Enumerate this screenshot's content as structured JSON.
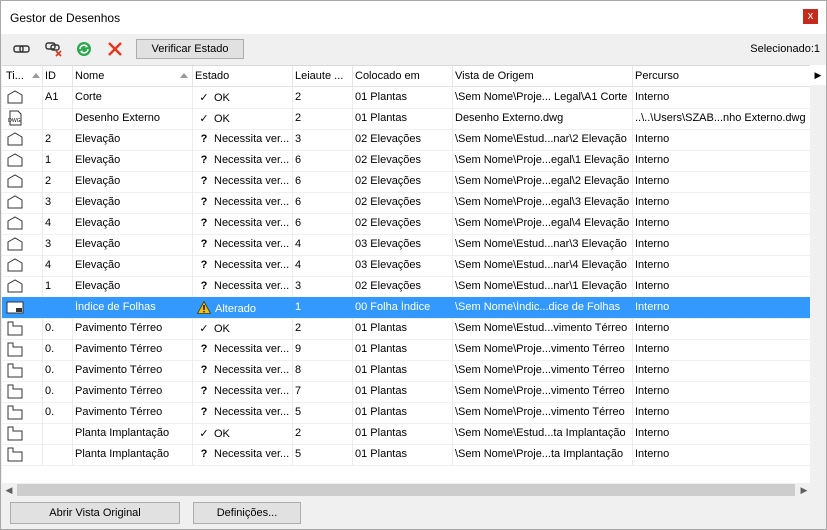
{
  "window": {
    "title": "Gestor de Desenhos",
    "close_symbol": "x"
  },
  "toolbar": {
    "verify_label": "Verificar Estado",
    "selected_label": "Selecionado:1"
  },
  "columns": [
    "Ti...",
    "ID",
    "Nome",
    "Estado",
    "Leiaute ...",
    "Colocado em",
    "Vista de Origem",
    "Percurso"
  ],
  "rows": [
    {
      "type": "section",
      "id": "A1",
      "name": "Corte",
      "status_icon": "check",
      "status": "OK",
      "layout": "2",
      "placed": "01 Plantas",
      "source": "\\Sem Nome\\Proje... Legal\\A1 Corte",
      "path": "Interno"
    },
    {
      "type": "dwg",
      "id": "",
      "name": "Desenho Externo",
      "status_icon": "check",
      "status": "OK",
      "layout": "2",
      "placed": "01 Plantas",
      "source": "Desenho Externo.dwg",
      "path": "..\\..\\Users\\SZAB...nho Externo.dwg"
    },
    {
      "type": "section",
      "id": "2",
      "name": "Elevação",
      "status_icon": "question",
      "status": "Necessita ver...",
      "layout": "3",
      "placed": "02 Elevações",
      "source": "\\Sem Nome\\Estud...nar\\2 Elevação",
      "path": "Interno"
    },
    {
      "type": "section",
      "id": "1",
      "name": "Elevação",
      "status_icon": "question",
      "status": "Necessita ver...",
      "layout": "6",
      "placed": "02 Elevações",
      "source": "\\Sem Nome\\Proje...egal\\1 Elevação",
      "path": "Interno"
    },
    {
      "type": "section",
      "id": "2",
      "name": "Elevação",
      "status_icon": "question",
      "status": "Necessita ver...",
      "layout": "6",
      "placed": "02 Elevações",
      "source": "\\Sem Nome\\Proje...egal\\2 Elevação",
      "path": "Interno"
    },
    {
      "type": "section",
      "id": "3",
      "name": "Elevação",
      "status_icon": "question",
      "status": "Necessita ver...",
      "layout": "6",
      "placed": "02 Elevações",
      "source": "\\Sem Nome\\Proje...egal\\3 Elevação",
      "path": "Interno"
    },
    {
      "type": "section",
      "id": "4",
      "name": "Elevação",
      "status_icon": "question",
      "status": "Necessita ver...",
      "layout": "6",
      "placed": "02 Elevações",
      "source": "\\Sem Nome\\Proje...egal\\4 Elevação",
      "path": "Interno"
    },
    {
      "type": "section",
      "id": "3",
      "name": "Elevação",
      "status_icon": "question",
      "status": "Necessita ver...",
      "layout": "4",
      "placed": "03 Elevações",
      "source": "\\Sem Nome\\Estud...nar\\3 Elevação",
      "path": "Interno"
    },
    {
      "type": "section",
      "id": "4",
      "name": "Elevação",
      "status_icon": "question",
      "status": "Necessita ver...",
      "layout": "4",
      "placed": "03 Elevações",
      "source": "\\Sem Nome\\Estud...nar\\4 Elevação",
      "path": "Interno"
    },
    {
      "type": "section",
      "id": "1",
      "name": "Elevação",
      "status_icon": "question",
      "status": "Necessita ver...",
      "layout": "3",
      "placed": "02 Elevações",
      "source": "\\Sem Nome\\Estud...nar\\1 Elevação",
      "path": "Interno"
    },
    {
      "type": "index",
      "id": "",
      "name": "Índice de Folhas",
      "status_icon": "warning",
      "status": "Alterado",
      "layout": "1",
      "placed": "00 Folha Índice",
      "source": "\\Sem Nome\\Índic...dice de Folhas",
      "path": "Interno",
      "selected": true
    },
    {
      "type": "plan",
      "id": "0.",
      "name": "Pavimento Térreo",
      "status_icon": "check",
      "status": "OK",
      "layout": "2",
      "placed": "01 Plantas",
      "source": "\\Sem Nome\\Estud...vimento Térreo",
      "path": "Interno"
    },
    {
      "type": "plan",
      "id": "0.",
      "name": "Pavimento Térreo",
      "status_icon": "question",
      "status": "Necessita ver...",
      "layout": "9",
      "placed": "01 Plantas",
      "source": "\\Sem Nome\\Proje...vimento Térreo",
      "path": "Interno"
    },
    {
      "type": "plan",
      "id": "0.",
      "name": "Pavimento Térreo",
      "status_icon": "question",
      "status": "Necessita ver...",
      "layout": "8",
      "placed": "01 Plantas",
      "source": "\\Sem Nome\\Proje...vimento Térreo",
      "path": "Interno"
    },
    {
      "type": "plan",
      "id": "0.",
      "name": "Pavimento Térreo",
      "status_icon": "question",
      "status": "Necessita ver...",
      "layout": "7",
      "placed": "01 Plantas",
      "source": "\\Sem Nome\\Proje...vimento Térreo",
      "path": "Interno"
    },
    {
      "type": "plan",
      "id": "0.",
      "name": "Pavimento Térreo",
      "status_icon": "question",
      "status": "Necessita ver...",
      "layout": "5",
      "placed": "01 Plantas",
      "source": "\\Sem Nome\\Proje...vimento Térreo",
      "path": "Interno"
    },
    {
      "type": "plan",
      "id": "",
      "name": "Planta Implantação",
      "status_icon": "check",
      "status": "OK",
      "layout": "2",
      "placed": "01 Plantas",
      "source": "\\Sem Nome\\Estud...ta Implantação",
      "path": "Interno"
    },
    {
      "type": "plan",
      "id": "",
      "name": "Planta Implantação",
      "status_icon": "question",
      "status": "Necessita ver...",
      "layout": "5",
      "placed": "01 Plantas",
      "source": "\\Sem Nome\\Proje...ta Implantação",
      "path": "Interno"
    }
  ],
  "buttons": {
    "open_original": "Abrir Vista Original",
    "settings": "Definições..."
  },
  "colors": {
    "selection": "#3399ff",
    "check": "#222222",
    "warning": "#f5c400",
    "refresh": "#2aa84a",
    "delete": "#e8341c"
  }
}
